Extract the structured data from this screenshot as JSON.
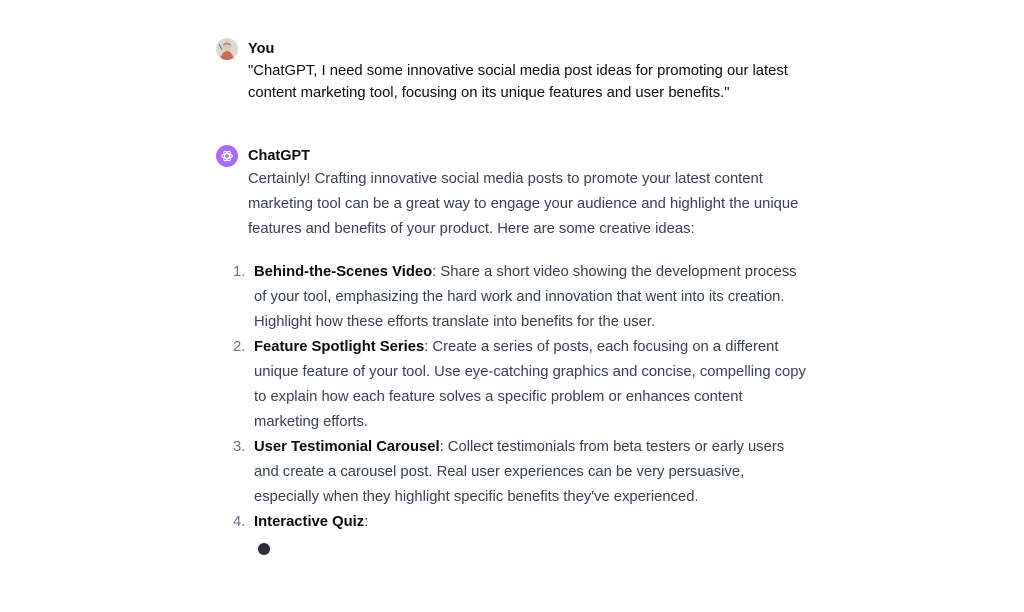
{
  "user_message": {
    "author": "You",
    "text": "\"ChatGPT, I need some innovative social media post ideas for promoting our latest content marketing tool, focusing on its unique features and user benefits.\""
  },
  "assistant_message": {
    "author": "ChatGPT",
    "intro": "Certainly! Crafting innovative social media posts to promote your latest content marketing tool can be a great way to engage your audience and highlight the unique features and benefits of your product. Here are some creative ideas:",
    "items": [
      {
        "number": "1.",
        "title": "Behind-the-Scenes Video",
        "body": ": Share a short video showing the development process of your tool, emphasizing the hard work and innovation that went into its creation. Highlight how these efforts translate into benefits for the user."
      },
      {
        "number": "2.",
        "title": "Feature Spotlight Series",
        "body": ": Create a series of posts, each focusing on a different unique feature of your tool. Use eye-catching graphics and concise, compelling copy to explain how each feature solves a specific problem or enhances content marketing efforts."
      },
      {
        "number": "3.",
        "title": "User Testimonial Carousel",
        "body": ": Collect testimonials from beta testers or early users and create a carousel post. Real user experiences can be very persuasive, especially when they highlight specific benefits they've experienced."
      },
      {
        "number": "4.",
        "title": "Interactive Quiz",
        "body": ":"
      }
    ]
  },
  "icons": {
    "user_avatar": "user-avatar-icon",
    "assistant_avatar": "openai-logo-icon",
    "streaming_cursor": "streaming-cursor-icon"
  },
  "colors": {
    "assistant_avatar_bg": "#ab68ff",
    "text_primary": "#0d0d0d",
    "text_body": "#374151"
  }
}
